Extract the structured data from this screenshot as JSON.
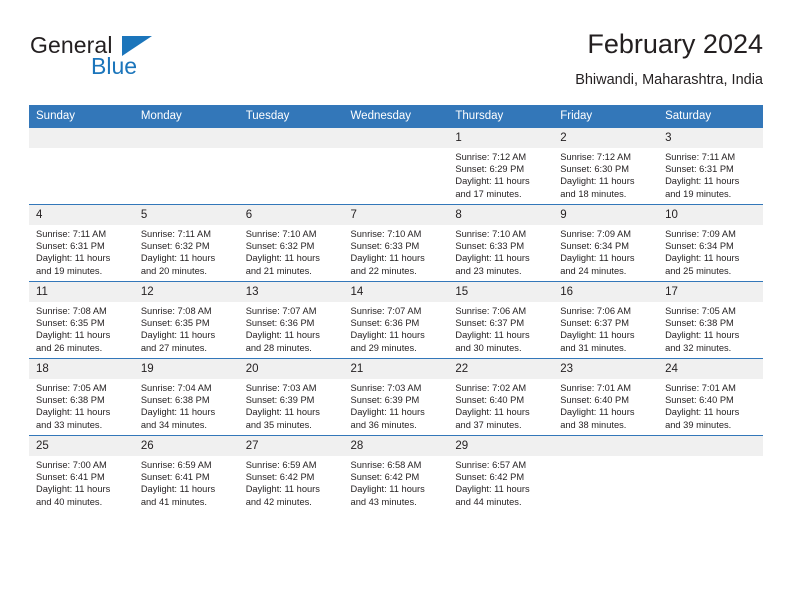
{
  "brand": {
    "word_primary": "General",
    "word_secondary": "Blue",
    "triangle_icon": "blue-triangle-icon",
    "primary_color": "#231f20",
    "accent_color": "#1b75bb"
  },
  "header": {
    "title": "February 2024",
    "subtitle": "Bhiwandi, Maharashtra, India"
  },
  "theme": {
    "header_blue": "#3377b9",
    "daynum_band": "#f0f0f0",
    "cell_background": "#ffffff",
    "text_color": "#231f20"
  },
  "calendar": {
    "weekday_headers": [
      "Sunday",
      "Monday",
      "Tuesday",
      "Wednesday",
      "Thursday",
      "Friday",
      "Saturday"
    ],
    "labels": {
      "sunrise": "Sunrise:",
      "sunset": "Sunset:",
      "daylight": "Daylight:"
    },
    "weeks": [
      [
        {
          "day": "",
          "empty": true
        },
        {
          "day": "",
          "empty": true
        },
        {
          "day": "",
          "empty": true
        },
        {
          "day": "",
          "empty": true
        },
        {
          "day": "1",
          "sunrise": "Sunrise: 7:12 AM",
          "sunset": "Sunset: 6:29 PM",
          "daylight": "Daylight: 11 hours and 17 minutes."
        },
        {
          "day": "2",
          "sunrise": "Sunrise: 7:12 AM",
          "sunset": "Sunset: 6:30 PM",
          "daylight": "Daylight: 11 hours and 18 minutes."
        },
        {
          "day": "3",
          "sunrise": "Sunrise: 7:11 AM",
          "sunset": "Sunset: 6:31 PM",
          "daylight": "Daylight: 11 hours and 19 minutes."
        }
      ],
      [
        {
          "day": "4",
          "sunrise": "Sunrise: 7:11 AM",
          "sunset": "Sunset: 6:31 PM",
          "daylight": "Daylight: 11 hours and 19 minutes."
        },
        {
          "day": "5",
          "sunrise": "Sunrise: 7:11 AM",
          "sunset": "Sunset: 6:32 PM",
          "daylight": "Daylight: 11 hours and 20 minutes."
        },
        {
          "day": "6",
          "sunrise": "Sunrise: 7:10 AM",
          "sunset": "Sunset: 6:32 PM",
          "daylight": "Daylight: 11 hours and 21 minutes."
        },
        {
          "day": "7",
          "sunrise": "Sunrise: 7:10 AM",
          "sunset": "Sunset: 6:33 PM",
          "daylight": "Daylight: 11 hours and 22 minutes."
        },
        {
          "day": "8",
          "sunrise": "Sunrise: 7:10 AM",
          "sunset": "Sunset: 6:33 PM",
          "daylight": "Daylight: 11 hours and 23 minutes."
        },
        {
          "day": "9",
          "sunrise": "Sunrise: 7:09 AM",
          "sunset": "Sunset: 6:34 PM",
          "daylight": "Daylight: 11 hours and 24 minutes."
        },
        {
          "day": "10",
          "sunrise": "Sunrise: 7:09 AM",
          "sunset": "Sunset: 6:34 PM",
          "daylight": "Daylight: 11 hours and 25 minutes."
        }
      ],
      [
        {
          "day": "11",
          "sunrise": "Sunrise: 7:08 AM",
          "sunset": "Sunset: 6:35 PM",
          "daylight": "Daylight: 11 hours and 26 minutes."
        },
        {
          "day": "12",
          "sunrise": "Sunrise: 7:08 AM",
          "sunset": "Sunset: 6:35 PM",
          "daylight": "Daylight: 11 hours and 27 minutes."
        },
        {
          "day": "13",
          "sunrise": "Sunrise: 7:07 AM",
          "sunset": "Sunset: 6:36 PM",
          "daylight": "Daylight: 11 hours and 28 minutes."
        },
        {
          "day": "14",
          "sunrise": "Sunrise: 7:07 AM",
          "sunset": "Sunset: 6:36 PM",
          "daylight": "Daylight: 11 hours and 29 minutes."
        },
        {
          "day": "15",
          "sunrise": "Sunrise: 7:06 AM",
          "sunset": "Sunset: 6:37 PM",
          "daylight": "Daylight: 11 hours and 30 minutes."
        },
        {
          "day": "16",
          "sunrise": "Sunrise: 7:06 AM",
          "sunset": "Sunset: 6:37 PM",
          "daylight": "Daylight: 11 hours and 31 minutes."
        },
        {
          "day": "17",
          "sunrise": "Sunrise: 7:05 AM",
          "sunset": "Sunset: 6:38 PM",
          "daylight": "Daylight: 11 hours and 32 minutes."
        }
      ],
      [
        {
          "day": "18",
          "sunrise": "Sunrise: 7:05 AM",
          "sunset": "Sunset: 6:38 PM",
          "daylight": "Daylight: 11 hours and 33 minutes."
        },
        {
          "day": "19",
          "sunrise": "Sunrise: 7:04 AM",
          "sunset": "Sunset: 6:38 PM",
          "daylight": "Daylight: 11 hours and 34 minutes."
        },
        {
          "day": "20",
          "sunrise": "Sunrise: 7:03 AM",
          "sunset": "Sunset: 6:39 PM",
          "daylight": "Daylight: 11 hours and 35 minutes."
        },
        {
          "day": "21",
          "sunrise": "Sunrise: 7:03 AM",
          "sunset": "Sunset: 6:39 PM",
          "daylight": "Daylight: 11 hours and 36 minutes."
        },
        {
          "day": "22",
          "sunrise": "Sunrise: 7:02 AM",
          "sunset": "Sunset: 6:40 PM",
          "daylight": "Daylight: 11 hours and 37 minutes."
        },
        {
          "day": "23",
          "sunrise": "Sunrise: 7:01 AM",
          "sunset": "Sunset: 6:40 PM",
          "daylight": "Daylight: 11 hours and 38 minutes."
        },
        {
          "day": "24",
          "sunrise": "Sunrise: 7:01 AM",
          "sunset": "Sunset: 6:40 PM",
          "daylight": "Daylight: 11 hours and 39 minutes."
        }
      ],
      [
        {
          "day": "25",
          "sunrise": "Sunrise: 7:00 AM",
          "sunset": "Sunset: 6:41 PM",
          "daylight": "Daylight: 11 hours and 40 minutes."
        },
        {
          "day": "26",
          "sunrise": "Sunrise: 6:59 AM",
          "sunset": "Sunset: 6:41 PM",
          "daylight": "Daylight: 11 hours and 41 minutes."
        },
        {
          "day": "27",
          "sunrise": "Sunrise: 6:59 AM",
          "sunset": "Sunset: 6:42 PM",
          "daylight": "Daylight: 11 hours and 42 minutes."
        },
        {
          "day": "28",
          "sunrise": "Sunrise: 6:58 AM",
          "sunset": "Sunset: 6:42 PM",
          "daylight": "Daylight: 11 hours and 43 minutes."
        },
        {
          "day": "29",
          "sunrise": "Sunrise: 6:57 AM",
          "sunset": "Sunset: 6:42 PM",
          "daylight": "Daylight: 11 hours and 44 minutes."
        },
        {
          "day": "",
          "empty": true
        },
        {
          "day": "",
          "empty": true
        }
      ]
    ]
  }
}
